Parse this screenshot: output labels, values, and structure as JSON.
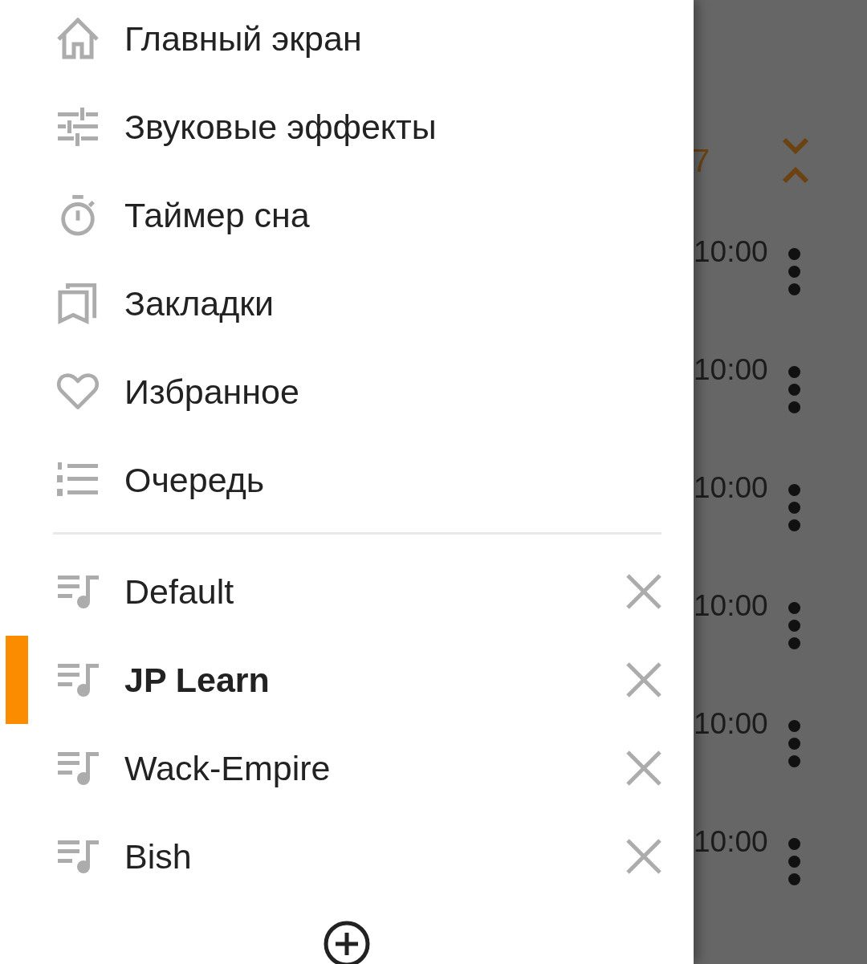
{
  "drawer": {
    "nav_items": [
      {
        "label": "Главный экран"
      },
      {
        "label": "Звуковые эффекты"
      },
      {
        "label": "Таймер сна"
      },
      {
        "label": "Закладки"
      },
      {
        "label": "Избранное"
      },
      {
        "label": "Очередь"
      }
    ],
    "playlists": [
      {
        "label": "Default",
        "selected": false
      },
      {
        "label": "JP Learn",
        "selected": true
      },
      {
        "label": "Wack-Empire",
        "selected": false
      },
      {
        "label": "Bish",
        "selected": false
      }
    ]
  },
  "background": {
    "header_number": "7",
    "times": [
      "10:00",
      "10:00",
      "10:00",
      "10:00",
      "10:00",
      "10:00"
    ]
  }
}
